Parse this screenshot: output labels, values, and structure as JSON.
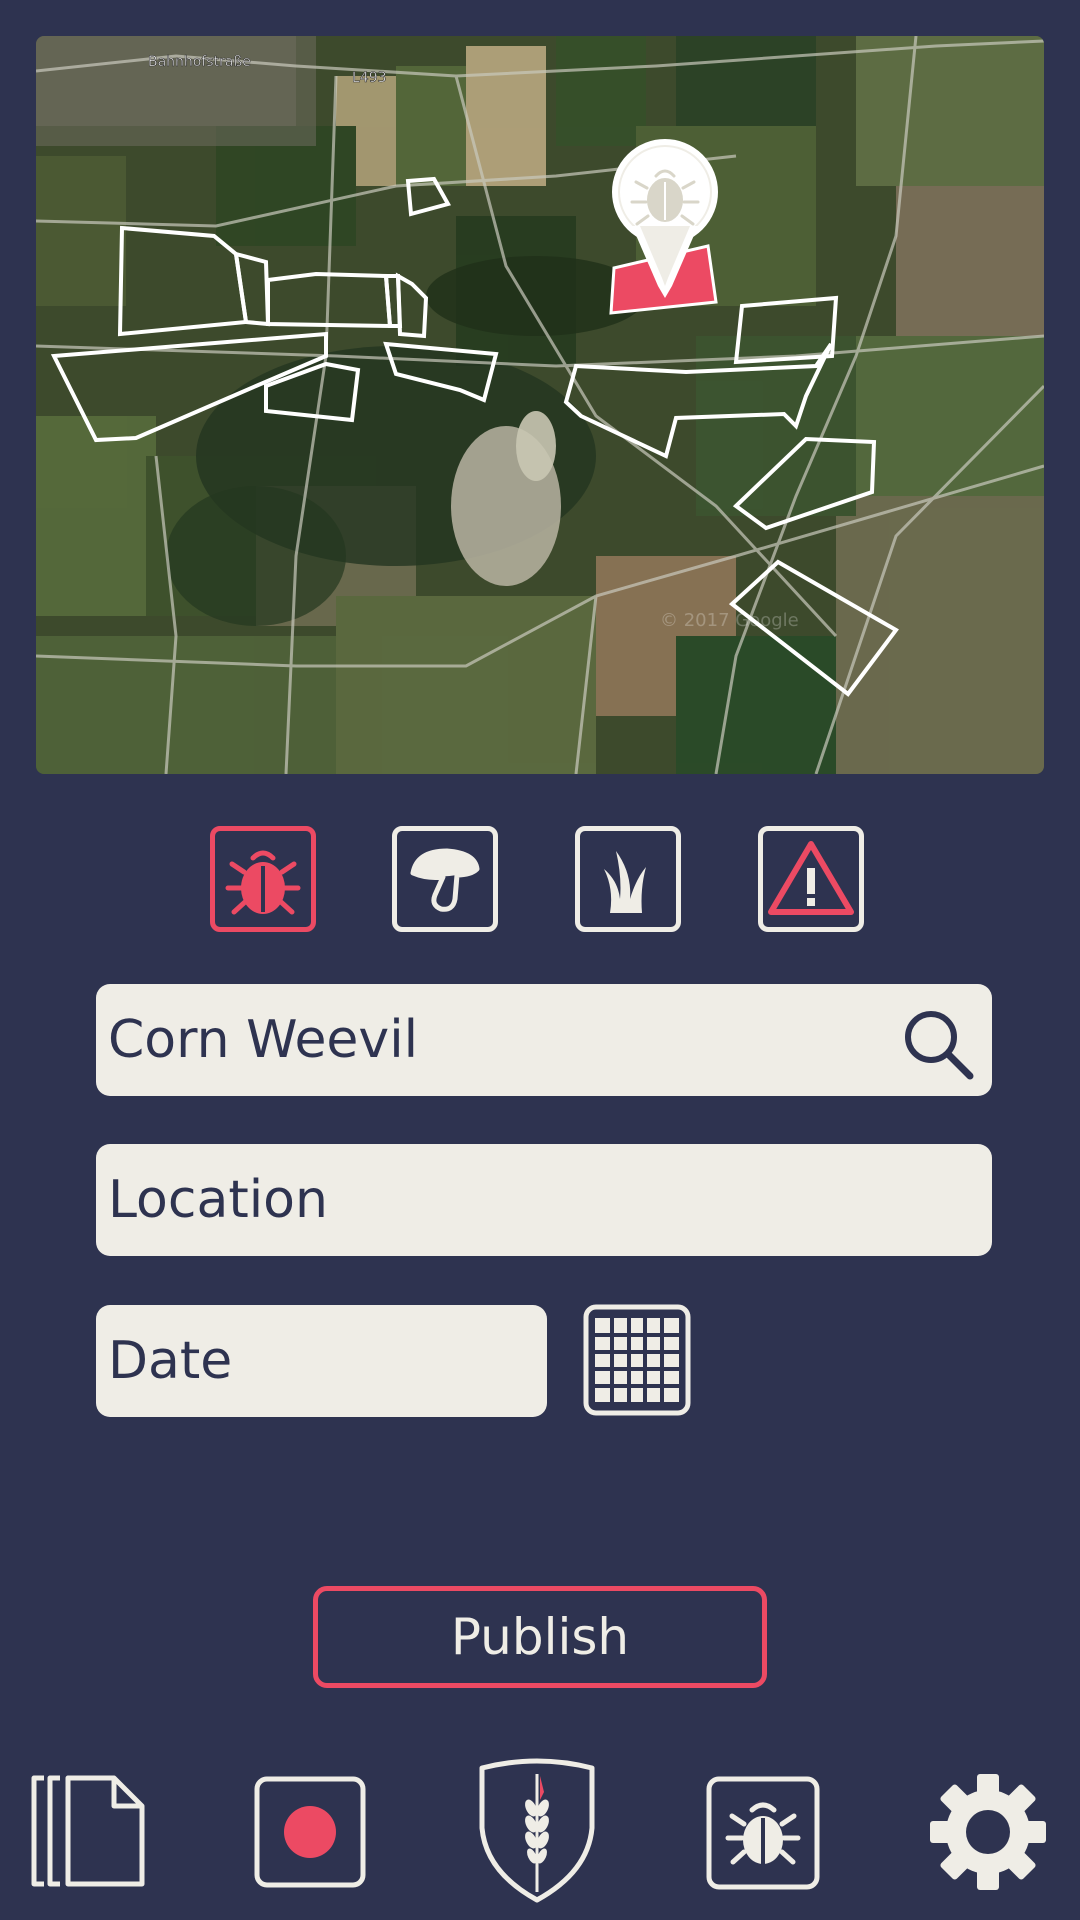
{
  "map": {
    "street_label": "Bahnhofstraße",
    "road_label": "L493",
    "watermark": "© 2017 Google",
    "marker_icon": "bug-icon"
  },
  "categories": [
    {
      "name": "pest",
      "icon": "bug-icon",
      "active": true
    },
    {
      "name": "fungus",
      "icon": "mushroom-icon",
      "active": false
    },
    {
      "name": "weed",
      "icon": "grass-icon",
      "active": false
    },
    {
      "name": "warning",
      "icon": "warning-icon",
      "active": false
    }
  ],
  "form": {
    "species_value": "Corn Weevil",
    "location_placeholder": "Location",
    "date_placeholder": "Date"
  },
  "actions": {
    "publish_label": "Publish"
  },
  "nav": {
    "items": [
      "documents-icon",
      "record-icon",
      "logo-shield",
      "bug-icon",
      "gear-icon"
    ]
  },
  "colors": {
    "background": "#2e3350",
    "accent": "#ec4a63",
    "field": "#efede6"
  }
}
